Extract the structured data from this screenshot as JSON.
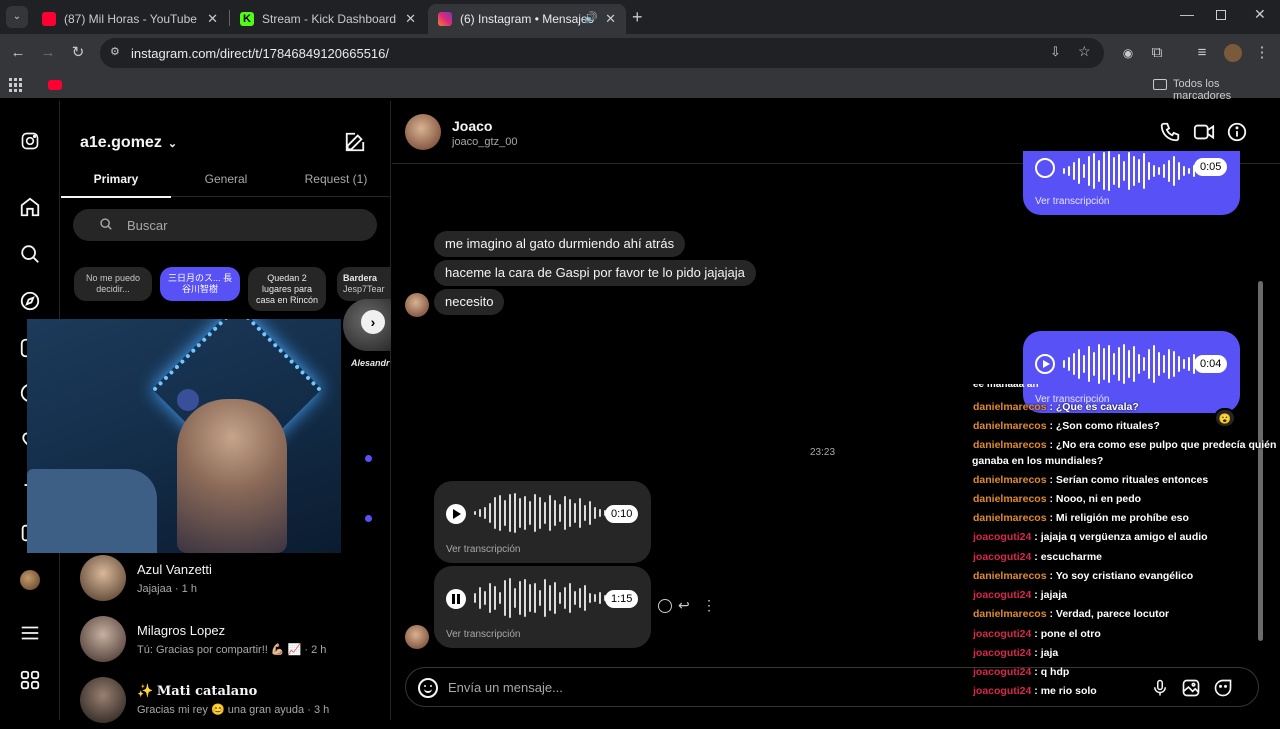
{
  "browser": {
    "tabs": [
      {
        "title": "(87) Mil Horas - YouTube",
        "favicon_color": "#ff0033",
        "active": false
      },
      {
        "title": "Stream - Kick Dashboard",
        "favicon_color": "#53fc18",
        "active": false
      },
      {
        "title": "(6) Instagram • Mensajes",
        "favicon_color": "#e1306c",
        "active": true
      }
    ],
    "url": "instagram.com/direct/t/17846849120665516/",
    "bookmarks_folder": "Todos los marcadores"
  },
  "inbox": {
    "username": "a1e.gomez",
    "tabs": [
      "Primary",
      "General",
      "Request (1)"
    ],
    "search_placeholder": "Buscar",
    "notes": [
      {
        "text": "No me puedo decidir..."
      },
      {
        "text": "三日月のス... 長谷川智樹"
      },
      {
        "text": "Quedan 2 lugares para casa en Rincón"
      },
      {
        "text": "Bardera",
        "sub": "Jesp7Tear"
      }
    ],
    "note_overflow_label": "Alesandr",
    "conversations": [
      {
        "name": "Azul Vanzetti",
        "preview": "Jajajaa",
        "time": "1 h"
      },
      {
        "name": "Milagros Lopez",
        "preview": "Tú: Gracias por compartir!! 💪🏼 📈",
        "time": "2 h"
      },
      {
        "name": "Mati catalano",
        "preview": "Gracias mi rey 😊 una gran ayuda",
        "time": "3 h",
        "prefix": "✨"
      }
    ]
  },
  "chat": {
    "contact_name": "Joaco",
    "contact_handle": "joaco_gtz_00",
    "messages_in": [
      "me imagino al gato durmiendo ahí atrás",
      "haceme la cara de Gaspi por favor te lo pido jajajaja",
      "necesito"
    ],
    "voice_out_top": {
      "duration": "0:05",
      "transcript_label": "Ver transcripción"
    },
    "voice_out_mid": {
      "duration": "0:04",
      "transcript_label": "Ver transcripción"
    },
    "reaction": "😮",
    "timestamp": "23:23",
    "voice_in_1": {
      "duration": "0:10",
      "transcript_label": "Ver transcripción"
    },
    "voice_in_2": {
      "duration": "1:15",
      "transcript_label": "Ver transcripción",
      "playback_progress": 0.02
    },
    "composer_placeholder": "Envía un mensaje..."
  },
  "stream_chat": [
    {
      "user": "danielmarecos",
      "text": "¿Que es cavala?",
      "color": "#e08a2c"
    },
    {
      "user": "danielmarecos",
      "text": "¿Son como rituales?",
      "color": "#e08a2c"
    },
    {
      "user": "danielmarecos",
      "text": "¿No era como ese pulpo que predecía quién",
      "color": "#e08a2c"
    },
    {
      "user": "",
      "text": "ganaba en los mundiales?",
      "color": "#e08a2c"
    },
    {
      "user": "danielmarecos",
      "text": "Serían como rituales entonces",
      "color": "#e08a2c"
    },
    {
      "user": "danielmarecos",
      "text": "Nooo, ni en pedo",
      "color": "#e08a2c"
    },
    {
      "user": "danielmarecos",
      "text": "Mi religión me prohíbe eso",
      "color": "#e08a2c"
    },
    {
      "user": "joacoguti24",
      "text": "jajaja q vergüenza amigo el audio",
      "color": "#d9264a"
    },
    {
      "user": "joacoguti24",
      "text": "escucharme",
      "color": "#d9264a"
    },
    {
      "user": "danielmarecos",
      "text": "Yo soy cristiano evangélico",
      "color": "#e08a2c"
    },
    {
      "user": "joacoguti24",
      "text": "jajaja",
      "color": "#d9264a"
    },
    {
      "user": "danielmarecos",
      "text": "Verdad, parece locutor",
      "color": "#e08a2c"
    },
    {
      "user": "joacoguti24",
      "text": "pone el otro",
      "color": "#d9264a"
    },
    {
      "user": "joacoguti24",
      "text": "jaja",
      "color": "#d9264a"
    },
    {
      "user": "joacoguti24",
      "text": "q hdp",
      "color": "#d9264a"
    },
    {
      "user": "joacoguti24",
      "text": "me rio solo",
      "color": "#d9264a"
    }
  ]
}
